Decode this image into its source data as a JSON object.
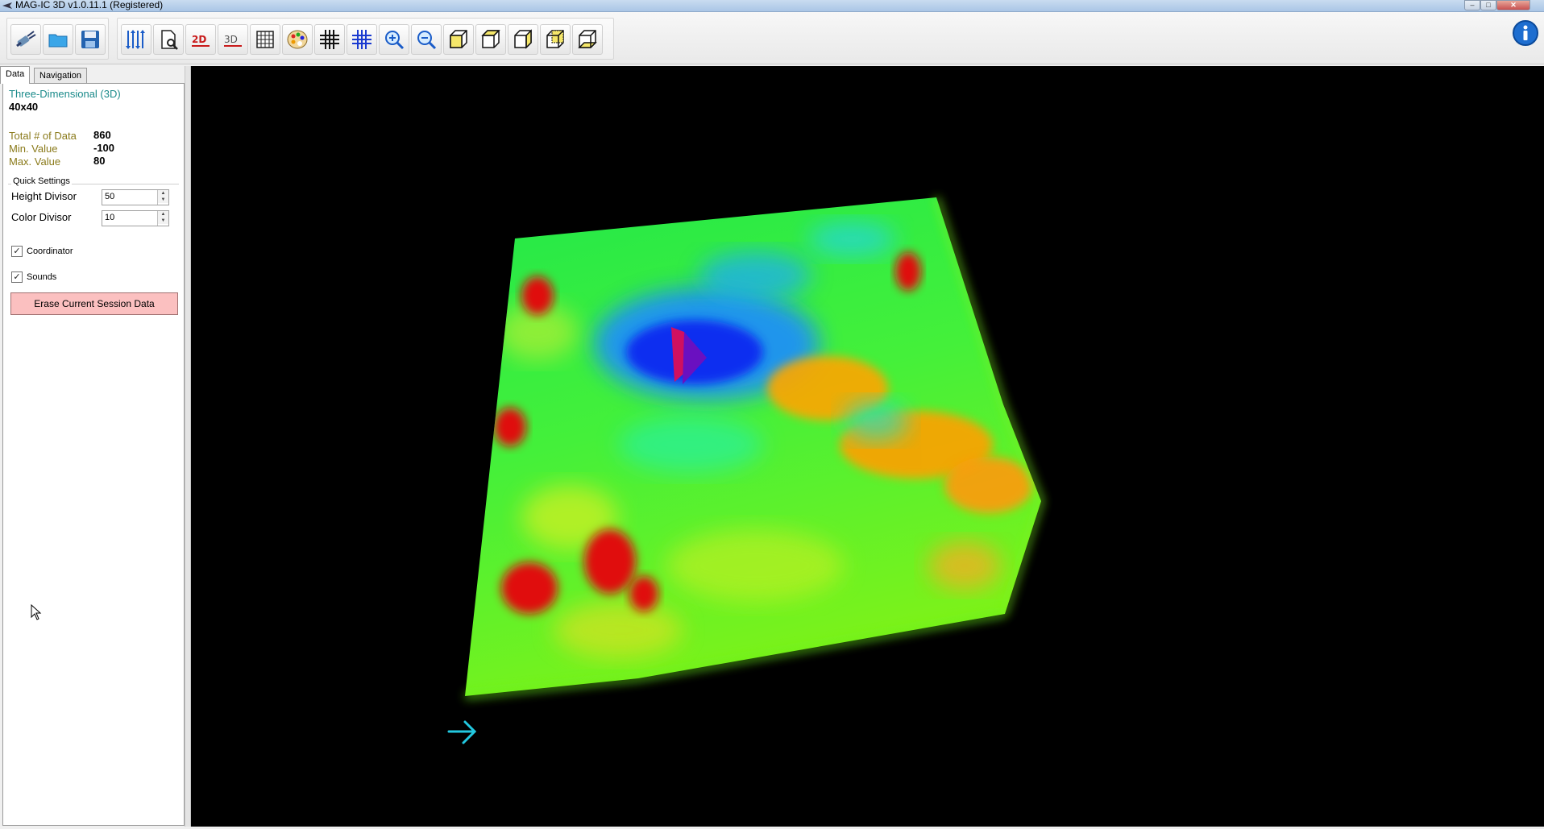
{
  "window": {
    "title": "MAG-IC 3D v1.0.11.1 (Registered)",
    "controls": {
      "minimize": "–",
      "maximize": "□",
      "close": "✕"
    }
  },
  "toolbar": {
    "file_buttons": [
      "connect-device-icon",
      "open-folder-icon",
      "save-icon"
    ],
    "view_buttons": [
      "data-columns-icon",
      "preview-icon",
      "2d-view-icon",
      "3d-view-icon",
      "grid-icon",
      "palette-icon",
      "grid-lines-icon",
      "grid-lines-blue-icon",
      "zoom-in-icon",
      "zoom-out-icon",
      "cube-view-1-icon",
      "cube-view-2-icon",
      "cube-view-3-icon",
      "cube-view-4-icon",
      "cube-view-5-icon"
    ],
    "label_2d": "2D",
    "label_3d": "3D",
    "info_icon": "info-icon"
  },
  "tabs": [
    {
      "label": "Data",
      "active": true
    },
    {
      "label": "Navigation",
      "active": false
    }
  ],
  "data_panel": {
    "mode": "Three-Dimensional (3D)",
    "grid_size": "40x40",
    "stats": [
      {
        "label": "Total # of Data",
        "value": "860"
      },
      {
        "label": "Min. Value",
        "value": "-100"
      },
      {
        "label": "Max. Value",
        "value": "80"
      }
    ],
    "quick_settings": {
      "title": "Quick Settings",
      "height_divisor": {
        "label": "Height Divisor",
        "value": "50"
      },
      "color_divisor": {
        "label": "Color Divisor",
        "value": "10"
      }
    },
    "coordinator": {
      "label": "Coordinator",
      "checked": true
    },
    "sounds": {
      "label": "Sounds",
      "checked": true
    },
    "erase_button": "Erase Current Session Data"
  },
  "colors": {
    "viewport_bg": "#000000",
    "erase_bg": "#fbc0c0",
    "label_teal": "#1a8a8a",
    "label_olive": "#8a7a1a",
    "axis_arrow": "#22c8e0"
  }
}
